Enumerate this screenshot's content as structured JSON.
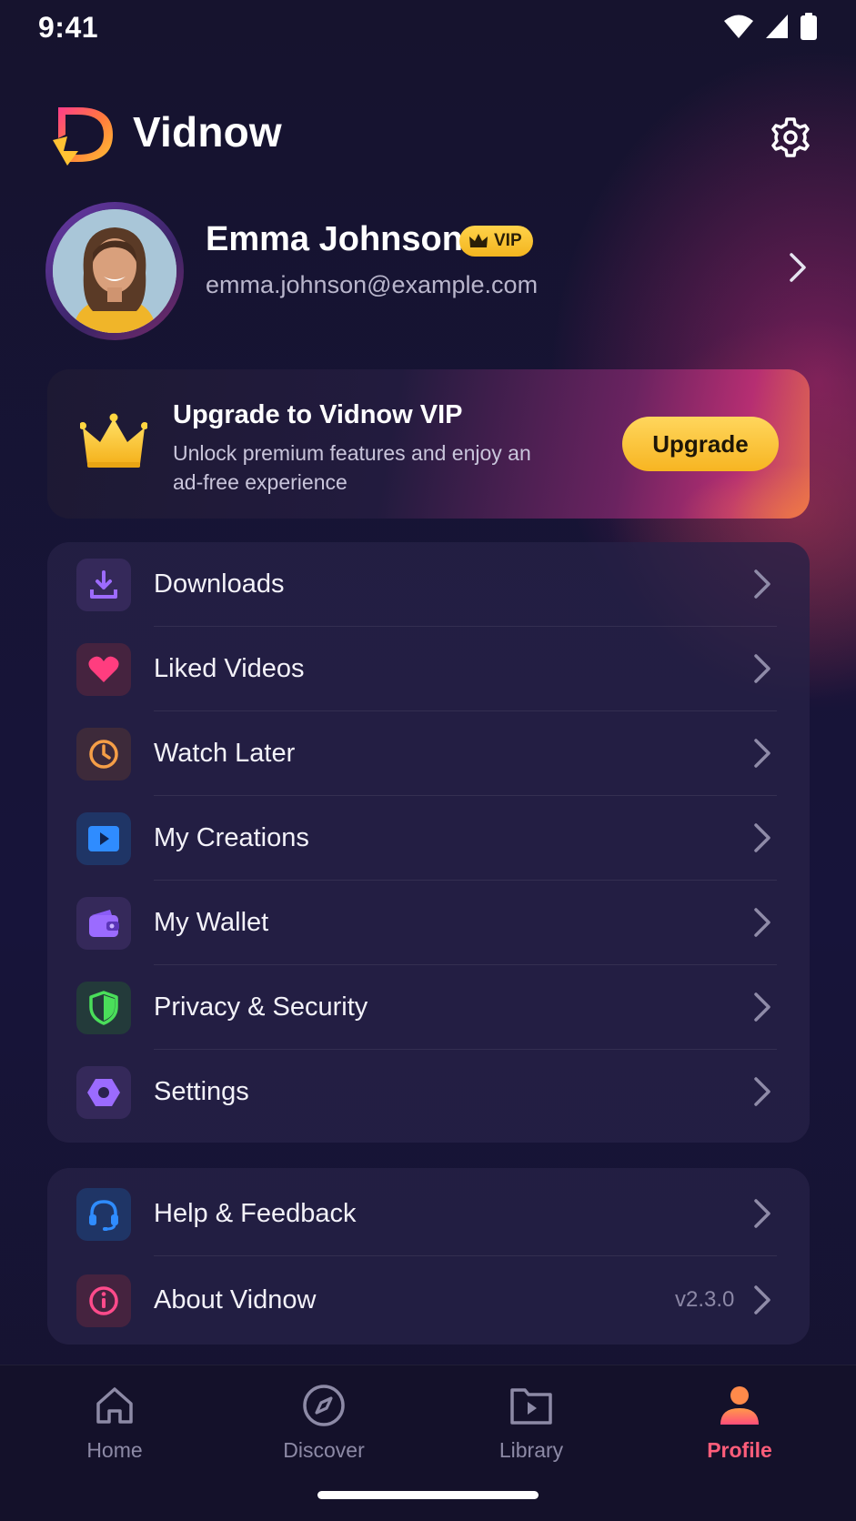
{
  "status_bar": {
    "time": "9:41"
  },
  "header": {
    "app_name": "Vidnow"
  },
  "profile": {
    "name": "Emma Johnson",
    "badge": "VIP",
    "email": "emma.johnson@example.com"
  },
  "upgrade": {
    "title": "Upgrade to Vidnow VIP",
    "description": "Unlock premium features and enjoy an ad-free experience",
    "button_label": "Upgrade"
  },
  "menu_primary": [
    {
      "label": "Downloads",
      "icon": "download-icon",
      "color": "#8b5cf6"
    },
    {
      "label": "Liked Videos",
      "icon": "heart-icon",
      "color": "#ff3d7f"
    },
    {
      "label": "Watch Later",
      "icon": "clock-icon",
      "color": "#f59e47"
    },
    {
      "label": "My Creations",
      "icon": "play-icon",
      "color": "#2f8cff"
    },
    {
      "label": "My Wallet",
      "icon": "wallet-icon",
      "color": "#8b5cf6"
    },
    {
      "label": "Privacy & Security",
      "icon": "shield-icon",
      "color": "#4ade5a"
    },
    {
      "label": "Settings",
      "icon": "hexagon-gear-icon",
      "color": "#8b5cf6"
    }
  ],
  "menu_secondary": [
    {
      "label": "Help & Feedback",
      "icon": "headset-icon",
      "color": "#2f8cff"
    },
    {
      "label": "About Vidnow",
      "icon": "info-icon",
      "color": "#ff4b8b",
      "value": "v2.3.0"
    }
  ],
  "bottom_nav": [
    {
      "label": "Home",
      "icon": "home-icon",
      "active": false
    },
    {
      "label": "Discover",
      "icon": "compass-icon",
      "active": false
    },
    {
      "label": "Library",
      "icon": "folder-play-icon",
      "active": false
    },
    {
      "label": "Profile",
      "icon": "person-icon",
      "active": true
    }
  ],
  "colors": {
    "background": "#15122d",
    "accent": "#ff5d7a",
    "vip_gold": "#f7b522"
  }
}
